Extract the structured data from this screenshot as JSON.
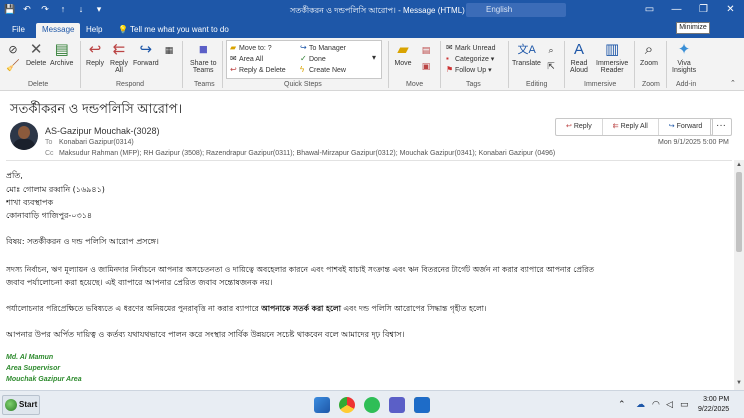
{
  "titlebar": {
    "title": "সতর্কীকরন ও দন্ডপলিসি আরোপ। - Message (HTML)",
    "search": "English",
    "tooltip": "Minimize"
  },
  "menu": {
    "file": "File",
    "message": "Message",
    "help": "Help",
    "tellme": "Tell me what you want to do"
  },
  "ribbon": {
    "delete": "Delete",
    "archive": "Archive",
    "delete_group": "Delete",
    "reply": "Reply",
    "reply_all_1": "Reply",
    "reply_all_2": "All",
    "forward": "Forward",
    "respond_group": "Respond",
    "share_1": "Share to",
    "share_2": "Teams",
    "teams_group": "Teams",
    "qs_move": "Move to: ?",
    "qs_area": "Area All",
    "qs_reply_delete": "Reply & Delete",
    "qs_manager": "To Manager",
    "qs_done": "Done",
    "qs_new": "Create New",
    "qs_group": "Quick Steps",
    "move": "Move",
    "move_group": "Move",
    "mark_unread": "Mark Unread",
    "categorize": "Categorize",
    "follow_up": "Follow Up",
    "tags_group": "Tags",
    "translate": "Translate",
    "editing_group": "Editing",
    "read_aloud_1": "Read",
    "read_aloud_2": "Aloud",
    "immersive_1": "Immersive",
    "immersive_2": "Reader",
    "immersive_group": "Immersive",
    "zoom": "Zoom",
    "zoom_group": "Zoom",
    "viva_1": "Viva",
    "viva_2": "Insights",
    "addin_group": "Add-in"
  },
  "email": {
    "subject": "সতর্কীকরন ও দন্ডপলিসি আরোপ।",
    "from": "AS-Gazipur Mouchak-(3028)",
    "to_label": "To",
    "to": "Konabari Gazipur(0314)",
    "cc_label": "Cc",
    "cc": "Maksudur Rahman (MFP); RH Gazipur (3508); Razendrapur Gazipur(0311); Bhawal-Mirzapur Gazipur(0312); Mouchak Gazipur(0341); Konabari Gazipur (0496)",
    "date": "Mon 9/1/2025 5:00 PM",
    "actions": {
      "reply": "Reply",
      "reply_all": "Reply All",
      "forward": "Forward",
      "more": "···"
    },
    "body": {
      "l1": "প্রতি,",
      "l2": "মোঃ গোলাম রব্বানি (১৬৯৪১)",
      "l3": "শাখা ব্যবস্থাপক",
      "l4": "কোনাবাড়ি গাজিপুর-০৩১৪",
      "l5": "বিষয়: সতর্কীকরন ও দন্ড পলিসি আরোপ প্রসঙ্গে।",
      "l6": "সদস্য নির্বাচন, ঋণ মূল্যায়ন ও জামিনদার নির্বাচনে আপনার অসচেতনতা ও দায়িত্বে অবহেলার কারনে এবং পাশবই যাচাই সংক্রান্ত এবং ঋন বিতরনের টার্গেট অর্জন না করার ব্যাপারে আপনার প্রেরিত",
      "l7": "জবাব পর্যালোচনা করা হয়েছে। এই ব্যাপারে আপনার প্রেরিত জবাব সন্তোষজনক নয়।",
      "l8a": "পর্যালোচনার পরিপ্রেক্ষিতে ভবিষ্যতে এ ধরণের অনিয়মের পুনরাবৃত্তি না করার ব্যাপারে",
      "l8b": "আপনাকে সতর্ক করা হলো",
      "l8c": "এবং দন্ড পলিসি আরোপের সিদ্ধান্ত গৃহীত হলো।",
      "l9": "আপনার উপর অর্পিত দায়িত্ব ও কর্তব্য যথাযথভাবে পালন করে সংস্থার সার্বিক উন্নয়নে সচেষ্ট থাকবেন বলে আমাদের দৃঢ় বিশ্বাস।",
      "sig1": "Md. Al Mamun",
      "sig2": "Area Supervisor",
      "sig3": "Mouchak Gazipur Area"
    }
  },
  "taskbar": {
    "start": "Start",
    "time": "3:00 PM",
    "date": "9/22/2025"
  },
  "colors": {
    "accent": "#1e57a8",
    "signature": "#2e8b2e"
  }
}
